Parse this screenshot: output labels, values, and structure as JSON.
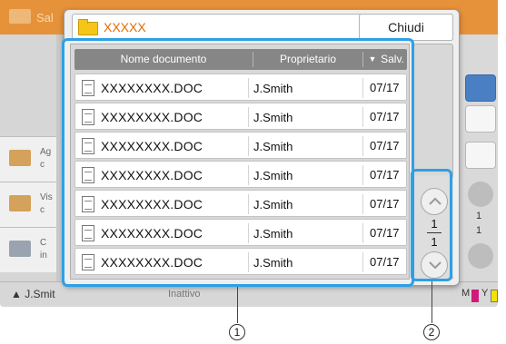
{
  "background": {
    "title": "Sal",
    "left_items": [
      {
        "label": "Ag\nc",
        "icon": "folder-add-icon"
      },
      {
        "label": "Vis\nc",
        "icon": "folder-view-icon"
      },
      {
        "label": "C\nin",
        "icon": "folder-settings-icon"
      }
    ],
    "status_user": "J.Smit",
    "status_state": "Inattivo",
    "toner_labels": [
      "M",
      "Y"
    ],
    "page_indicator": {
      "current": "1",
      "total": "1"
    }
  },
  "dialog": {
    "folder_name": "XXXXX",
    "close_label": "Chiudi",
    "columns": {
      "name": "Nome documento",
      "owner": "Proprietario",
      "saved": "Salv.",
      "sort_indicator": "▼"
    },
    "rows": [
      {
        "name": "XXXXXXXX.DOC",
        "owner": "J.Smith",
        "date": "07/17"
      },
      {
        "name": "XXXXXXXX.DOC",
        "owner": "J.Smith",
        "date": "07/17"
      },
      {
        "name": "XXXXXXXX.DOC",
        "owner": "J.Smith",
        "date": "07/17"
      },
      {
        "name": "XXXXXXXX.DOC",
        "owner": "J.Smith",
        "date": "07/17"
      },
      {
        "name": "XXXXXXXX.DOC",
        "owner": "J.Smith",
        "date": "07/17"
      },
      {
        "name": "XXXXXXXX.DOC",
        "owner": "J.Smith",
        "date": "07/17"
      },
      {
        "name": "XXXXXXXX.DOC",
        "owner": "J.Smith",
        "date": "07/17"
      }
    ],
    "pager": {
      "current": "1",
      "total": "1"
    }
  },
  "callouts": {
    "one": "1",
    "two": "2"
  },
  "colors": {
    "accent": "#2ea0e6",
    "header_bg": "#868686",
    "folder_text": "#e36b00",
    "orange": "#e6923a"
  }
}
